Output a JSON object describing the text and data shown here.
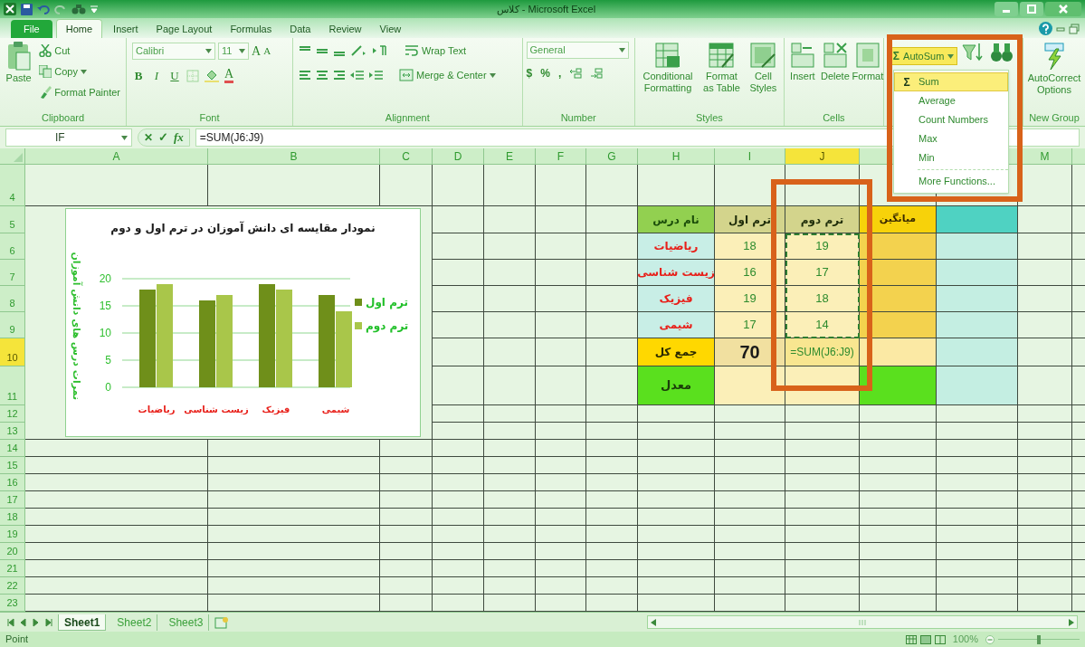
{
  "title_bar": {
    "title": "کلاس - Microsoft Excel"
  },
  "ribbon_tabs": [
    {
      "label": "File",
      "kind": "file",
      "selected": false
    },
    {
      "label": "Home",
      "kind": "tab",
      "selected": true
    },
    {
      "label": "Insert",
      "kind": "tab",
      "selected": false
    },
    {
      "label": "Page Layout",
      "kind": "tab",
      "selected": false
    },
    {
      "label": "Formulas",
      "kind": "tab",
      "selected": false
    },
    {
      "label": "Data",
      "kind": "tab",
      "selected": false
    },
    {
      "label": "Review",
      "kind": "tab",
      "selected": false
    },
    {
      "label": "View",
      "kind": "tab",
      "selected": false
    }
  ],
  "ribbon": {
    "clipboard": {
      "label": "Clipboard",
      "paste": "Paste",
      "cut": "Cut",
      "copy": "Copy",
      "format_painter": "Format Painter"
    },
    "font": {
      "label": "Font",
      "font_name": "Calibri",
      "font_size": "11",
      "size_buttons": [
        "A",
        "A"
      ],
      "style_buttons": [
        "B",
        "I",
        "U"
      ],
      "color_button": "A"
    },
    "alignment": {
      "label": "Alignment",
      "wrap_text": "Wrap Text",
      "merge_center": "Merge & Center"
    },
    "number": {
      "label": "Number",
      "format": "General",
      "symbols": [
        "$",
        "%",
        ","
      ]
    },
    "styles": {
      "label": "Styles",
      "buttons": [
        "Conditional Formatting",
        "Format as Table",
        "Cell Styles"
      ]
    },
    "cells": {
      "label": "Cells",
      "buttons": [
        "Insert",
        "Delete",
        "Format"
      ]
    },
    "editing": {
      "autosum_icon": "Σ",
      "autosum": "AutoSum",
      "menu_open": true
    },
    "new_group": {
      "label": "New Group",
      "buttons": [
        "AutoCorrect Options"
      ]
    }
  },
  "autosum_menu": [
    {
      "icon": "Σ",
      "label": "Sum",
      "selected": true,
      "separator_before": false
    },
    {
      "label": "Average",
      "selected": false,
      "separator_before": false
    },
    {
      "label": "Count Numbers",
      "selected": false,
      "separator_before": false
    },
    {
      "label": "Max",
      "selected": false,
      "separator_before": false
    },
    {
      "label": "Min",
      "selected": false,
      "separator_before": false
    },
    {
      "label": "More Functions...",
      "selected": false,
      "separator_before": true
    }
  ],
  "formula_bar": {
    "name_box": "IF",
    "cancel": "✕",
    "enter": "✓",
    "function": "fx",
    "formula": "=SUM(J6:J9)"
  },
  "columns": [
    {
      "label": "A",
      "selected": false
    },
    {
      "label": "B",
      "selected": false
    },
    {
      "label": "C",
      "selected": false
    },
    {
      "label": "D",
      "selected": false
    },
    {
      "label": "E",
      "selected": false
    },
    {
      "label": "F",
      "selected": false
    },
    {
      "label": "G",
      "selected": false
    },
    {
      "label": "H",
      "selected": false
    },
    {
      "label": "I",
      "selected": false
    },
    {
      "label": "J",
      "selected": true
    },
    {
      "selected": false
    },
    {
      "selected": false
    },
    {
      "label": "M",
      "selected": false
    }
  ],
  "rows": [
    {
      "label": "4",
      "selected": false
    },
    {
      "label": "5",
      "selected": false
    },
    {
      "label": "6",
      "selected": false
    },
    {
      "label": "7",
      "selected": false
    },
    {
      "label": "8",
      "selected": false
    },
    {
      "label": "9",
      "selected": false
    },
    {
      "label": "10",
      "selected": true
    },
    {
      "label": "11",
      "selected": false
    },
    {
      "label": "12",
      "selected": false
    },
    {
      "label": "13",
      "selected": false
    },
    {
      "label": "14",
      "selected": false
    },
    {
      "label": "15",
      "selected": false
    },
    {
      "label": "16",
      "selected": false
    },
    {
      "label": "17",
      "selected": false
    },
    {
      "label": "18",
      "selected": false
    },
    {
      "label": "19",
      "selected": false
    },
    {
      "label": "20",
      "selected": false
    },
    {
      "label": "21",
      "selected": false
    },
    {
      "label": "22",
      "selected": false
    },
    {
      "label": "23",
      "selected": false
    }
  ],
  "grade_table": {
    "header": {
      "subject": "نام درس",
      "term1": "ترم اول",
      "term2": "ترم دوم",
      "average": "میانگین"
    },
    "rows": [
      {
        "subject": "ریاضیات",
        "term1": "18",
        "term2": "19"
      },
      {
        "subject": "زیست شناسی",
        "term1": "16",
        "term2": "17"
      },
      {
        "subject": "فیزیک",
        "term1": "19",
        "term2": "18"
      },
      {
        "subject": "شیمی",
        "term1": "17",
        "term2": "14"
      }
    ],
    "total": {
      "label": "جمع کل",
      "term1": "70",
      "term2": "=SUM(J6:J9)"
    },
    "average": {
      "label": "معدل"
    }
  },
  "chart": {
    "chart_data": {
      "type": "bar",
      "title": "نمودار مقایسه ای دانش آموزان در ترم اول و دوم",
      "ylabel": "نمرات درس های دانش آموزان",
      "categories": [
        "ریاضیات",
        "زیست شناسی",
        "فیزیک",
        "شیمی"
      ],
      "series": [
        {
          "name": "ترم اول",
          "color": "#6f8f1a",
          "values": [
            18,
            16,
            19,
            17
          ]
        },
        {
          "name": "ترم دوم",
          "color": "#a9c64a",
          "values": [
            19,
            17,
            18,
            14
          ]
        }
      ],
      "ylim": [
        0,
        20
      ],
      "yticks": [
        0,
        5,
        10,
        15,
        20
      ],
      "grid": true,
      "legend": true
    }
  },
  "sheet_tabs": [
    {
      "label": "Sheet1",
      "selected": true
    },
    {
      "label": "Sheet2",
      "selected": false
    },
    {
      "label": "Sheet3",
      "selected": false
    }
  ],
  "status_bar": {
    "mode": "Point",
    "zoom": "100%",
    "level": 0.5
  }
}
